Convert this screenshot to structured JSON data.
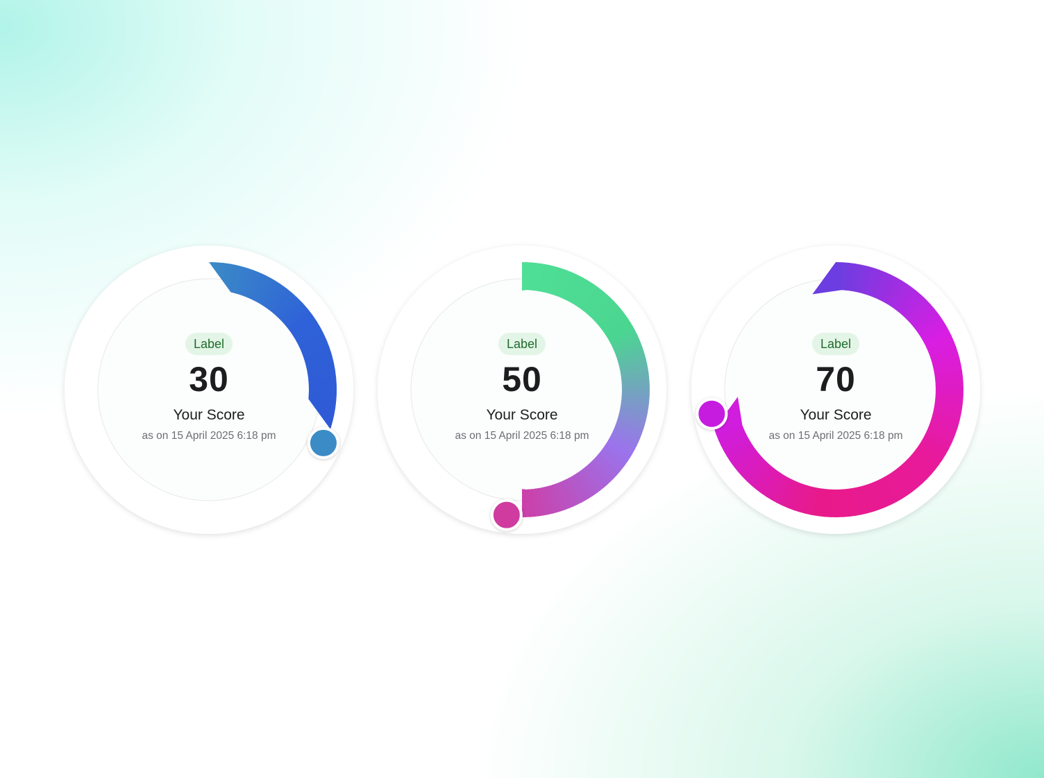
{
  "gauges": [
    {
      "badge": "Label",
      "score": "30",
      "score_label": "Your Score",
      "timestamp": "as on 15 April 2025 6:18 pm",
      "progress": 0.3,
      "gradient": [
        "#3b8bc6",
        "#2f62d8",
        "#2f5ad6"
      ],
      "knob_color": "#3b8bc6"
    },
    {
      "badge": "Label",
      "score": "50",
      "score_label": "Your Score",
      "timestamp": "as on 15 April 2025 6:18 pm",
      "progress": 0.5,
      "gradient": [
        "#4fdf96",
        "#4bd690",
        "#9a74ec",
        "#cc3fa8"
      ],
      "knob_color": "#cf3a9f"
    },
    {
      "badge": "Label",
      "score": "70",
      "score_label": "Your Score",
      "timestamp": "as on 15 April 2025 6:18 pm",
      "progress": 0.7,
      "gradient": [
        "#6a3ee0",
        "#d81ee3",
        "#e81a9a",
        "#e81a8a",
        "#cf1de0"
      ],
      "knob_color": "#c61fe0"
    }
  ]
}
